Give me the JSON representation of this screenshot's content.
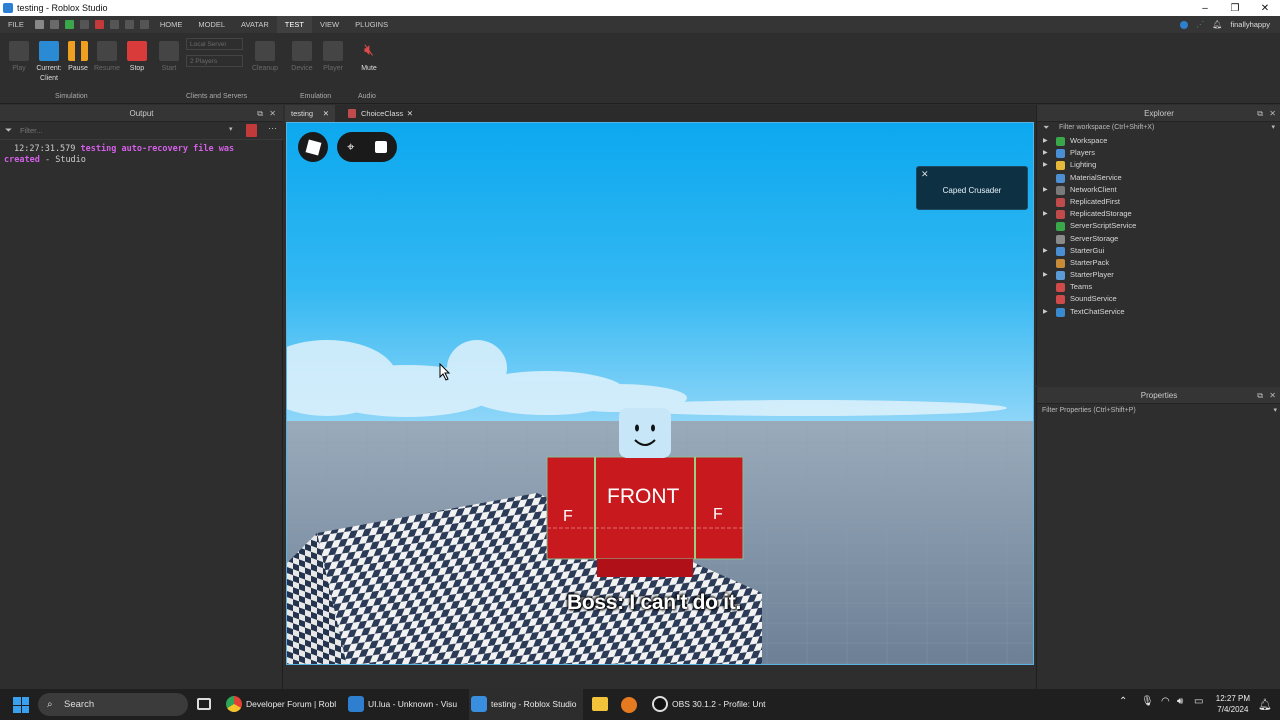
{
  "window": {
    "title": "testing - Roblox Studio",
    "controls": [
      "–",
      "❐",
      "✕"
    ]
  },
  "menu": {
    "file": "FILE",
    "home": "HOME",
    "model": "MODEL",
    "avatar": "AVATAR",
    "test": "TEST",
    "view": "VIEW",
    "plugins": "PLUGINS",
    "user": "finallyhappy"
  },
  "ribbon": {
    "play": "Play",
    "current_client": "Current:",
    "client": "Client",
    "pause": "Pause",
    "resume": "Resume",
    "stop": "Stop",
    "start": "Start",
    "local_server": "Local Server",
    "players_count": "2 Players",
    "cleanup": "Cleanup",
    "device": "Device",
    "player": "Player",
    "mute": "Mute",
    "groups": {
      "simulation": "Simulation",
      "clients_servers": "Clients and Servers",
      "emulation": "Emulation",
      "audio": "Audio"
    }
  },
  "output": {
    "title": "Output",
    "filter_placeholder": "Filter...",
    "lines": [
      {
        "time": "12:27:31.579",
        "message": "testing auto-recovery file was",
        "message2": "created",
        "source": "Studio"
      }
    ]
  },
  "tabs": [
    {
      "label": "testing"
    },
    {
      "label": "ChoiceClass"
    }
  ],
  "viewport": {
    "notification": "Caped Crusader",
    "subtitle": "Boss: I can't do it.",
    "shirt_front": "FRONT",
    "shirt_side": "F"
  },
  "explorer": {
    "title": "Explorer",
    "filter": "Filter workspace (Ctrl+Shift+X)",
    "items": [
      {
        "label": "Workspace",
        "expandable": true,
        "color": "#3aa84a"
      },
      {
        "label": "Players",
        "expandable": true,
        "color": "#4a8fd4"
      },
      {
        "label": "Lighting",
        "expandable": true,
        "color": "#e6b93a"
      },
      {
        "label": "MaterialService",
        "expandable": false,
        "color": "#4d8fd0"
      },
      {
        "label": "NetworkClient",
        "expandable": true,
        "color": "#7a7a7a"
      },
      {
        "label": "ReplicatedFirst",
        "expandable": false,
        "color": "#c14a4a"
      },
      {
        "label": "ReplicatedStorage",
        "expandable": true,
        "color": "#c14a4a"
      },
      {
        "label": "ServerScriptService",
        "expandable": false,
        "color": "#3aa84a"
      },
      {
        "label": "ServerStorage",
        "expandable": false,
        "color": "#8a8a8a"
      },
      {
        "label": "StarterGui",
        "expandable": true,
        "color": "#4a8fd4"
      },
      {
        "label": "StarterPack",
        "expandable": false,
        "color": "#c78b3a"
      },
      {
        "label": "StarterPlayer",
        "expandable": true,
        "color": "#5a9bd8"
      },
      {
        "label": "Teams",
        "expandable": false,
        "color": "#d04a4a"
      },
      {
        "label": "SoundService",
        "expandable": false,
        "color": "#d04a4a"
      },
      {
        "label": "TextChatService",
        "expandable": true,
        "color": "#3a8ad0"
      }
    ]
  },
  "properties": {
    "title": "Properties",
    "filter": "Filter Properties (Ctrl+Shift+P)"
  },
  "taskbar": {
    "search": "Search",
    "apps": [
      {
        "label": "Developer Forum | Robl",
        "color": "#e8a33a"
      },
      {
        "label": "UI.lua - Unknown - Visu",
        "color": "#2f7fd0"
      },
      {
        "label": "testing - Roblox Studio",
        "color": "#3a8ee0"
      },
      {
        "label": "OBS 30.1.2 - Profile: Unt",
        "color": "#222222"
      }
    ],
    "time": "12:27 PM",
    "date": "7/4/2024"
  }
}
